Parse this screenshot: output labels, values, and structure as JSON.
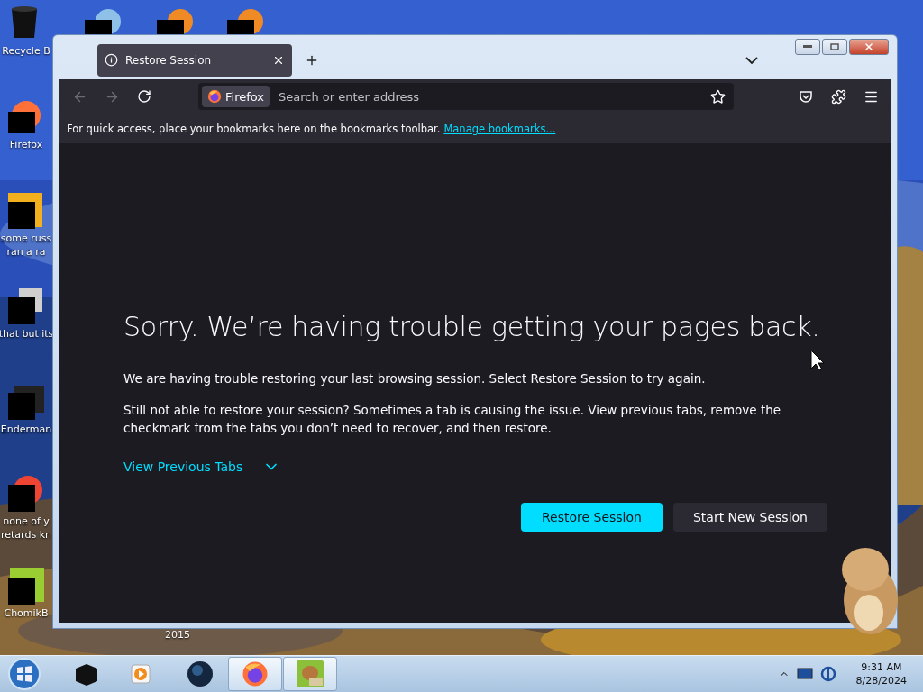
{
  "desktop_icons": [
    {
      "kind": "bin",
      "lines": [
        "Recycle B"
      ]
    },
    {
      "kind": "fox",
      "lines": [
        "Firefox"
      ]
    },
    {
      "kind": "yellow",
      "lines": [
        "some russ",
        "ran a ra"
      ]
    },
    {
      "kind": "stack",
      "lines": [
        "that but its"
      ]
    },
    {
      "kind": "terminal",
      "lines": [
        "Enderman"
      ]
    },
    {
      "kind": "red",
      "lines": [
        "none of y",
        "retards kn"
      ]
    },
    {
      "kind": "hamster",
      "lines": [
        "ChomikB"
      ]
    }
  ],
  "desktop_text": "2015",
  "window": {
    "tabs": [
      {
        "label": "Restore Session",
        "selected": true
      }
    ],
    "address": {
      "identity": "Firefox",
      "placeholder": "Search or enter address"
    },
    "bookmarks_bar": {
      "text": "For quick access, place your bookmarks here on the bookmarks toolbar.",
      "link": "Manage bookmarks..."
    },
    "page": {
      "title": "Sorry. We’re having trouble getting your pages back.",
      "paragraphs": [
        "We are having trouble restoring your last browsing session. Select Restore Session to try again.",
        "Still not able to restore your session? Sometimes a tab is causing the issue. View previous tabs, remove the checkmark from the tabs you don’t need to recover, and then restore."
      ],
      "toggle": {
        "label": "View Previous Tabs",
        "expanded": false
      },
      "buttons": [
        {
          "label": "Restore Session",
          "kind": "primary"
        },
        {
          "label": "Start New Session",
          "kind": "secondary"
        }
      ]
    }
  },
  "taskbar": {
    "apps": [
      {
        "kind": "box",
        "active": false
      },
      {
        "kind": "player",
        "active": false
      },
      {
        "kind": "globe",
        "active": false
      },
      {
        "kind": "fox",
        "active": true
      },
      {
        "kind": "hamster",
        "active": true
      }
    ],
    "clock": {
      "time": "9:31 AM",
      "date": "8/28/2024"
    }
  }
}
